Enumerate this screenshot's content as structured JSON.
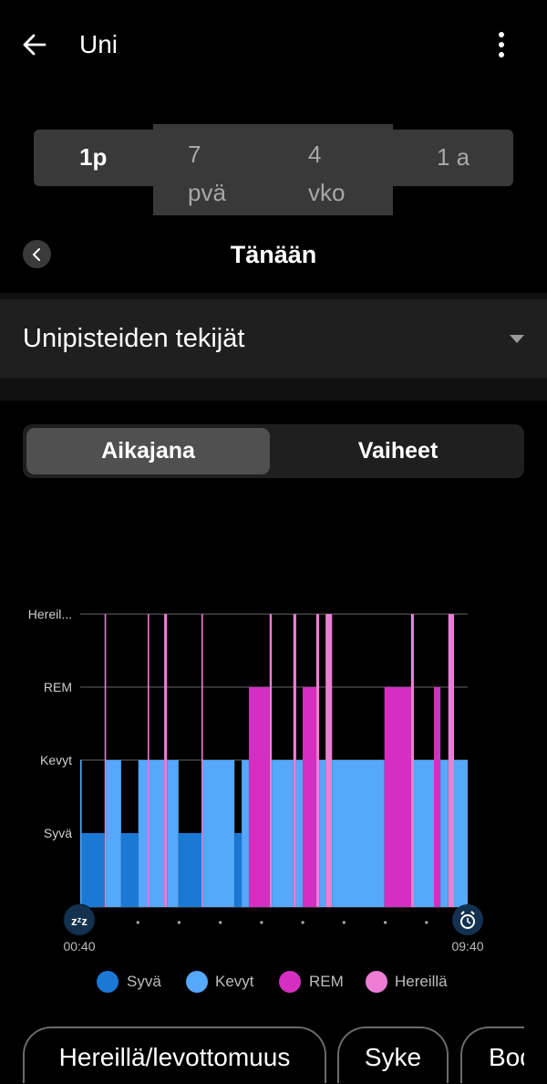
{
  "header": {
    "title": "Uni",
    "back_icon": "arrow-left-icon",
    "more_icon": "more-vertical-icon"
  },
  "range_selector": {
    "options": [
      {
        "line1": "1p",
        "line2": "",
        "selected": true
      },
      {
        "line1": "7",
        "line2": "pvä",
        "selected": false
      },
      {
        "line1": "4",
        "line2": "vko",
        "selected": false
      },
      {
        "line1": "1 a",
        "line2": "",
        "selected": false
      }
    ]
  },
  "date_nav": {
    "label": "Tänään",
    "prev_icon": "chevron-left-icon"
  },
  "dropdown": {
    "label": "Unipisteiden tekijät",
    "icon": "caret-down-icon"
  },
  "view_toggle": {
    "options": [
      "Aikajana",
      "Vaiheet"
    ],
    "selected": "Aikajana"
  },
  "colors": {
    "Syvä": "#1b78d4",
    "Kevyt": "#55a8fb",
    "REM": "#d42fc0",
    "Hereillä": "#ed7ed6"
  },
  "chart_data": {
    "type": "timeline",
    "title": "",
    "y_levels": [
      "Syvä",
      "Kevyt",
      "REM",
      "Hereil..."
    ],
    "stage_order": [
      "Syvä",
      "Kevyt",
      "REM",
      "Hereillä"
    ],
    "x_start": "00:40",
    "x_end": "09:40",
    "x_unit": "minutes since 00:40",
    "total_minutes": 540,
    "start_icon": "sleep-zzz-icon",
    "end_icon": "alarm-clock-icon",
    "segments": [
      {
        "stage": "Kevyt",
        "start": 0,
        "end": 2
      },
      {
        "stage": "Syvä",
        "start": 2,
        "end": 34
      },
      {
        "stage": "Hereillä",
        "start": 34,
        "end": 36
      },
      {
        "stage": "Kevyt",
        "start": 36,
        "end": 57
      },
      {
        "stage": "Syvä",
        "start": 57,
        "end": 81
      },
      {
        "stage": "Kevyt",
        "start": 81,
        "end": 94
      },
      {
        "stage": "Hereillä",
        "start": 94,
        "end": 96
      },
      {
        "stage": "Kevyt",
        "start": 96,
        "end": 117
      },
      {
        "stage": "Hereillä",
        "start": 117,
        "end": 121
      },
      {
        "stage": "Kevyt",
        "start": 121,
        "end": 137
      },
      {
        "stage": "Syvä",
        "start": 137,
        "end": 169
      },
      {
        "stage": "Hereillä",
        "start": 169,
        "end": 171
      },
      {
        "stage": "Kevyt",
        "start": 171,
        "end": 215
      },
      {
        "stage": "Syvä",
        "start": 215,
        "end": 225
      },
      {
        "stage": "Kevyt",
        "start": 225,
        "end": 235
      },
      {
        "stage": "REM",
        "start": 235,
        "end": 264
      },
      {
        "stage": "Hereillä",
        "start": 264,
        "end": 267
      },
      {
        "stage": "Kevyt",
        "start": 267,
        "end": 297
      },
      {
        "stage": "Hereillä",
        "start": 297,
        "end": 301
      },
      {
        "stage": "Kevyt",
        "start": 301,
        "end": 310
      },
      {
        "stage": "REM",
        "start": 310,
        "end": 329
      },
      {
        "stage": "Hereillä",
        "start": 329,
        "end": 333
      },
      {
        "stage": "Kevyt",
        "start": 333,
        "end": 342
      },
      {
        "stage": "Hereillä",
        "start": 342,
        "end": 351
      },
      {
        "stage": "Kevyt",
        "start": 351,
        "end": 424
      },
      {
        "stage": "REM",
        "start": 424,
        "end": 461
      },
      {
        "stage": "Hereillä",
        "start": 461,
        "end": 465
      },
      {
        "stage": "Kevyt",
        "start": 465,
        "end": 493
      },
      {
        "stage": "REM",
        "start": 493,
        "end": 502
      },
      {
        "stage": "Kevyt",
        "start": 502,
        "end": 513
      },
      {
        "stage": "Hereillä",
        "start": 513,
        "end": 521
      },
      {
        "stage": "Kevyt",
        "start": 521,
        "end": 540
      }
    ],
    "x_tick_count_dots": 8,
    "legend": [
      "Syvä",
      "Kevyt",
      "REM",
      "Hereillä"
    ],
    "legend_position": "bottom",
    "grid": true
  },
  "chips": [
    "Hereillä/levottomuus",
    "Syke",
    "Body"
  ]
}
